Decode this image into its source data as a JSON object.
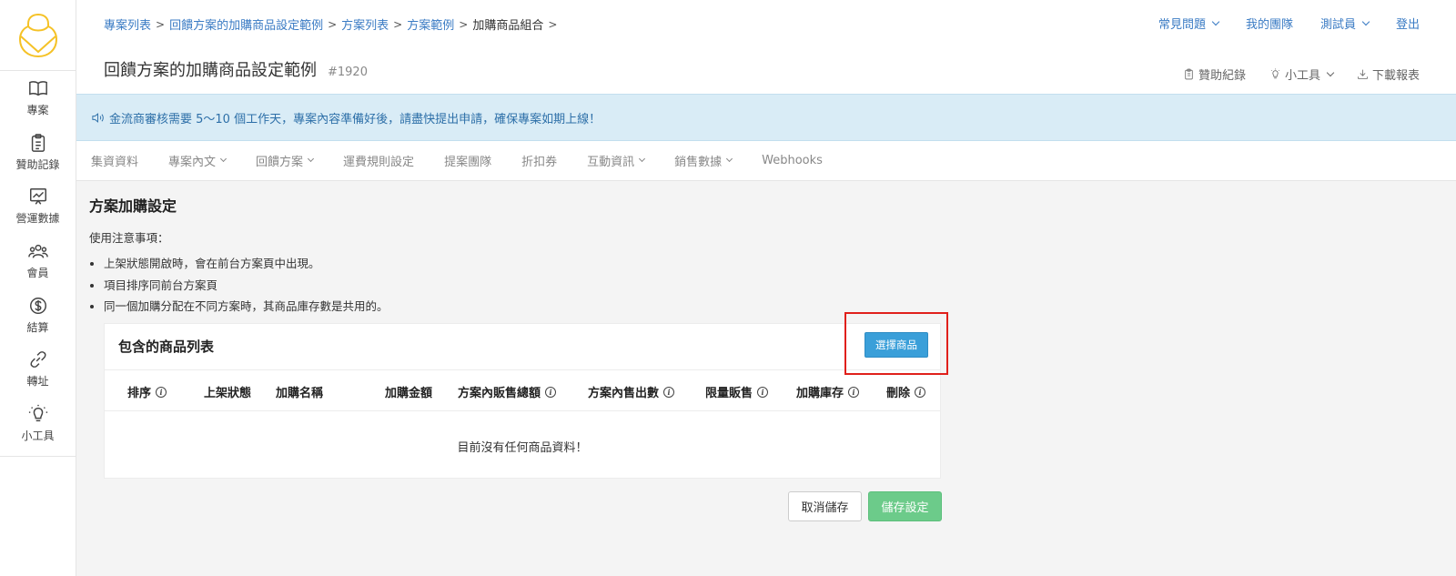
{
  "sidebar": {
    "items": [
      {
        "label": "專案",
        "icon": "book-icon"
      },
      {
        "label": "贊助記錄",
        "icon": "clipboard-icon"
      },
      {
        "label": "營運數據",
        "icon": "chart-icon"
      },
      {
        "label": "會員",
        "icon": "users-icon"
      },
      {
        "label": "結算",
        "icon": "dollar-icon"
      },
      {
        "label": "轉址",
        "icon": "link-icon"
      },
      {
        "label": "小工具",
        "icon": "lightbulb-icon"
      }
    ]
  },
  "breadcrumb": [
    "專案列表",
    "回饋方案的加購商品設定範例",
    "方案列表",
    "方案範例",
    "加購商品組合"
  ],
  "top_nav": {
    "faq": "常見問題",
    "my_team": "我的團隊",
    "user": "測試員",
    "logout": "登出"
  },
  "page": {
    "title": "回饋方案的加購商品設定範例",
    "id": "#1920"
  },
  "tools": {
    "sponsor_records": "贊助紀錄",
    "widgets": "小工具",
    "download_report": "下載報表"
  },
  "notice": "金流商審核需要 5～10 個工作天，專案內容準備好後，請盡快提出申請，確保專案如期上線！",
  "tabs": [
    {
      "label": "集資資料",
      "dropdown": false
    },
    {
      "label": "專案內文",
      "dropdown": true
    },
    {
      "label": "回饋方案",
      "dropdown": true
    },
    {
      "label": "運費規則設定",
      "dropdown": false
    },
    {
      "label": "提案團隊",
      "dropdown": false
    },
    {
      "label": "折扣券",
      "dropdown": false
    },
    {
      "label": "互動資訊",
      "dropdown": true
    },
    {
      "label": "銷售數據",
      "dropdown": true
    },
    {
      "label": "Webhooks",
      "dropdown": false
    }
  ],
  "section": {
    "title": "方案加購設定",
    "notes_label": "使用注意事項：",
    "notes": [
      "上架狀態開啟時，會在前台方案頁中出現。",
      "項目排序同前台方案頁",
      "同一個加購分配在不同方案時，其商品庫存數是共用的。"
    ]
  },
  "card": {
    "title": "包含的商品列表",
    "select_button": "選擇商品",
    "columns": [
      "排序",
      "上架狀態",
      "加購名稱",
      "加購金額",
      "方案內販售總額",
      "方案內售出數",
      "限量販售",
      "加購庫存",
      "刪除"
    ],
    "empty_text": "目前沒有任何商品資料！"
  },
  "actions": {
    "cancel": "取消儲存",
    "save": "儲存設定"
  },
  "colors": {
    "link": "#3a7bc4",
    "notice_bg": "#d9ecf6",
    "primary_btn": "#3a9fd9",
    "save_btn": "#6ccb8a",
    "highlight": "#e0201b"
  }
}
